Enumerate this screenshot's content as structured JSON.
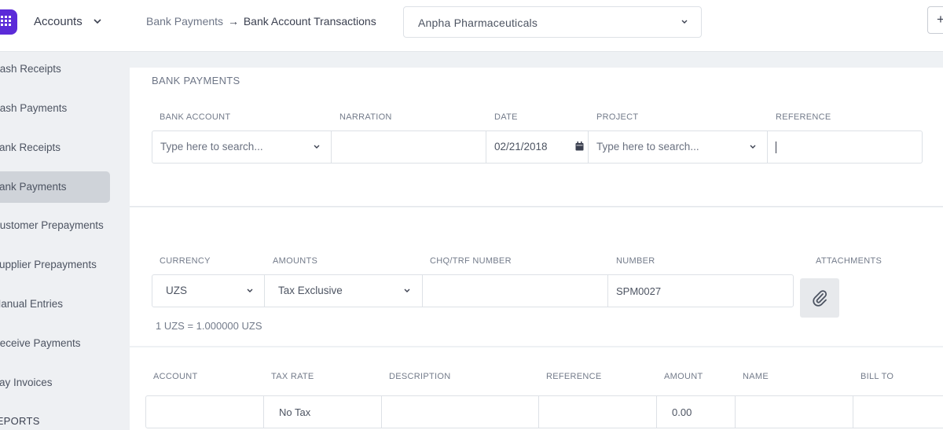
{
  "sidebar": {
    "module": "Accounts",
    "items": [
      {
        "label": "Cash Receipts",
        "active": false
      },
      {
        "label": "Cash Payments",
        "active": false
      },
      {
        "label": "Bank Receipts",
        "active": false
      },
      {
        "label": "Bank Payments",
        "active": true
      },
      {
        "label": "Customer Prepayments",
        "active": false
      },
      {
        "label": "Supplier Prepayments",
        "active": false
      },
      {
        "label": "Manual Entries",
        "active": false
      },
      {
        "label": "Receive Payments",
        "active": false
      },
      {
        "label": "Pay Invoices",
        "active": false
      }
    ],
    "section": "REPORTS"
  },
  "header": {
    "breadcrumb_parent": "Bank Payments",
    "breadcrumb_arrow": "→",
    "breadcrumb_current": "Bank Account Transactions",
    "company": "Anpha Pharmaceuticals",
    "top_button": "+"
  },
  "form": {
    "title": "BANK PAYMENTS",
    "labels": {
      "bank_account": "BANK ACCOUNT",
      "narration": "NARRATION",
      "date": "DATE",
      "project": "PROJECT",
      "reference": "REFERENCE"
    },
    "bank_account_placeholder": "Type here to search...",
    "narration": "",
    "date": "02/21/2018",
    "project_placeholder": "Type here to search...",
    "reference": ""
  },
  "details": {
    "labels": {
      "currency": "CURRENCY",
      "amounts": "AMOUNTS",
      "chq_number": "CHQ/TRF NUMBER",
      "number": "NUMBER",
      "attachments": "ATTACHMENTS"
    },
    "currency": "UZS",
    "amounts": "Tax Exclusive",
    "chq_number": "",
    "number": "SPM0027",
    "exchange_rate": "1 UZS = 1.000000 UZS"
  },
  "lines": {
    "headers": [
      "ACCOUNT",
      "TAX RATE",
      "DESCRIPTION",
      "REFERENCE",
      "AMOUNT",
      "NAME",
      "BILL TO"
    ],
    "rows": [
      {
        "account": "",
        "tax_rate": "No Tax",
        "description": "",
        "reference": "",
        "amount": "0.00",
        "name": "",
        "bill_to": ""
      }
    ]
  },
  "colors": {
    "brand": "#5b2bd8",
    "active_item": "#cfd3d9"
  }
}
